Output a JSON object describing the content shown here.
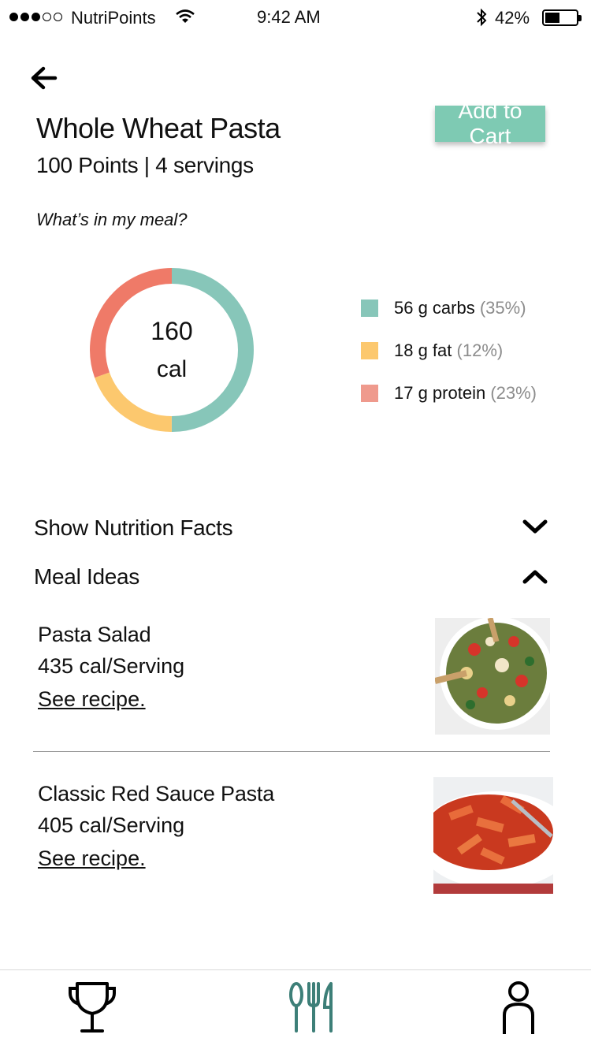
{
  "status_bar": {
    "carrier": "NutriPoints",
    "time": "9:42 AM",
    "battery": "42%",
    "signal_bars_filled": 3,
    "signal_bars_total": 5,
    "battery_level": 0.42
  },
  "header": {
    "title": "Whole Wheat Pasta",
    "subtitle": "100 Points | 4 servings",
    "add_to_cart": "Add to Cart"
  },
  "meal_breakdown": {
    "question": "What’s in my meal?",
    "calories": "160",
    "calories_unit": "cal",
    "items": [
      {
        "amount": "56 g carbs",
        "percent": "(35%)",
        "color": "#87c6b9"
      },
      {
        "amount": "18 g fat",
        "percent": "(12%)",
        "color": "#fcc86e"
      },
      {
        "amount": "17 g protein",
        "percent": "(23%)",
        "color": "#ef9a8d"
      }
    ]
  },
  "sections": {
    "nutrition_facts": "Show Nutrition Facts",
    "meal_ideas": "Meal Ideas"
  },
  "meal_ideas": [
    {
      "name": "Pasta Salad",
      "calories": "435 cal/Serving",
      "link": "See recipe."
    },
    {
      "name": "Classic Red Sauce Pasta",
      "calories": "405 cal/Serving",
      "link": "See recipe."
    }
  ],
  "tabbar": {
    "icons": [
      "trophy-icon",
      "utensils-icon",
      "profile-icon"
    ],
    "active_color": "#3d7f78"
  }
}
